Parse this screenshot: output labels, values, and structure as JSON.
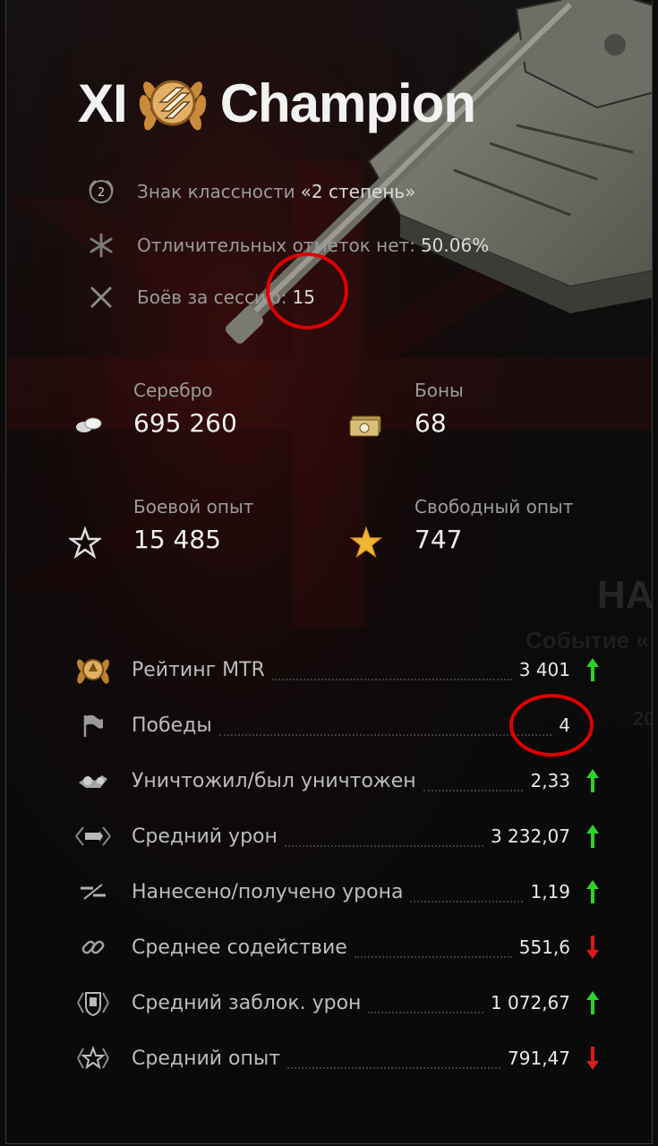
{
  "title": {
    "tier": "XI",
    "name": "Champion"
  },
  "info": [
    {
      "icon": "class-badge-icon",
      "label": "Знак классности",
      "value": "«2 степень»"
    },
    {
      "icon": "marks-of-excellence-icon",
      "label": "Отличительных отметок нет:",
      "value": "50.06%"
    },
    {
      "icon": "crossed-swords-icon",
      "label": "Боёв за сессию:",
      "value": "15"
    }
  ],
  "currencies": {
    "silver": {
      "label": "Серебро",
      "value": "695 260",
      "icon": "silver-icon"
    },
    "bonds": {
      "label": "Боны",
      "value": "68",
      "icon": "bonds-icon"
    },
    "battle_xp": {
      "label": "Боевой опыт",
      "value": "15 485",
      "icon": "star-outline-icon"
    },
    "free_xp": {
      "label": "Свободный опыт",
      "value": "747",
      "icon": "gold-star-icon"
    }
  },
  "stats": [
    {
      "label": "Рейтинг MTR",
      "value": "3 401",
      "trend": "up",
      "icon": "rating-laurel-icon"
    },
    {
      "label": "Победы",
      "value": "4",
      "trend": "none",
      "icon": "flag-icon"
    },
    {
      "label": "Уничтожил/был уничтожен",
      "value": "2,33",
      "trend": "up",
      "icon": "destroyed-tanks-icon"
    },
    {
      "label": "Средний урон",
      "value": "3 232,07",
      "trend": "up",
      "icon": "damage-icon"
    },
    {
      "label": "Нанесено/получено урона",
      "value": "1,19",
      "trend": "up",
      "icon": "damage-ratio-icon"
    },
    {
      "label": "Среднее содействие",
      "value": "551,6",
      "trend": "down",
      "icon": "assist-chain-icon"
    },
    {
      "label": "Средний заблок. урон",
      "value": "1 072,67",
      "trend": "up",
      "icon": "blocked-shield-icon"
    },
    {
      "label": "Средний опыт",
      "value": "791,47",
      "trend": "down",
      "icon": "average-xp-star-icon"
    }
  ],
  "background_text": {
    "line1": "НА",
    "line2": "Событие «",
    "line3": "20"
  },
  "colors": {
    "up": "#2fd12f",
    "down": "#d81b1b",
    "gold": "#d8a54a",
    "annotation": "#e00000"
  }
}
